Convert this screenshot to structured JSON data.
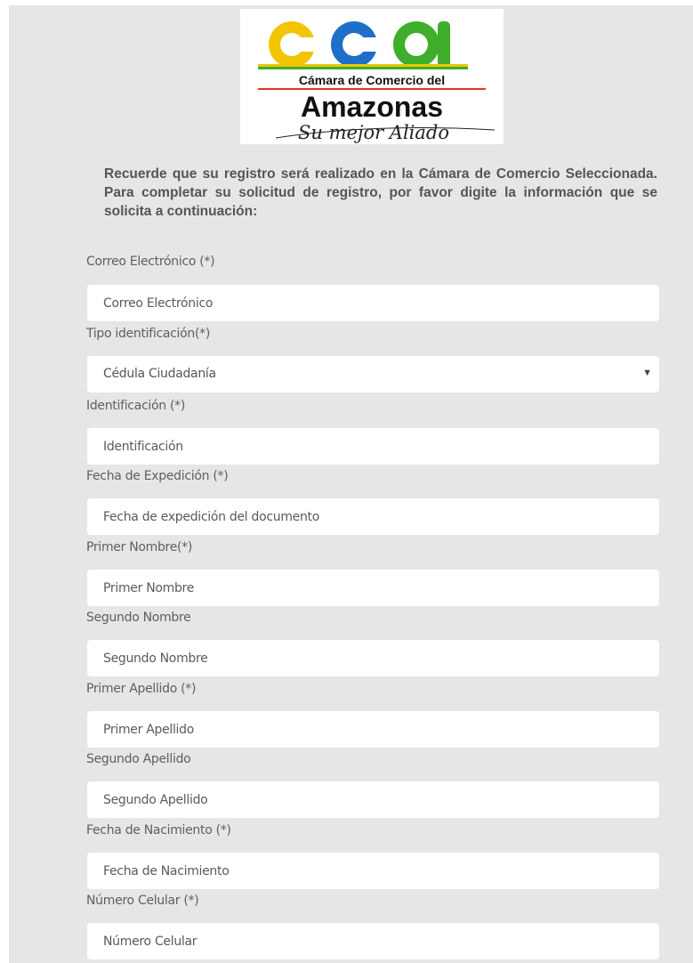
{
  "logo": {
    "line1": "Cámara de Comercio del",
    "line2": "Amazonas",
    "tagline": "Su mejor Aliado",
    "colors": {
      "yellow": "#f2c500",
      "blue": "#1e6fc8",
      "green": "#3fae2a",
      "red": "#e63228"
    }
  },
  "intro": "Recuerde que su registro será realizado en la Cámara de Comercio Seleccionada. Para completar su solicitud de registro, por favor digite la información que se solicita a continuación:",
  "form": {
    "email": {
      "label": "Correo Electrónico (*)",
      "placeholder": "Correo Electrónico"
    },
    "id_type": {
      "label": "Tipo identificación(*)",
      "selected": "Cédula Ciudadanía",
      "arrow_icon": "triangle-down-icon"
    },
    "id_number": {
      "label": "Identificación (*)",
      "placeholder": "Identificación"
    },
    "issue_date": {
      "label": "Fecha de Expedición (*)",
      "placeholder": "Fecha de expedición del documento"
    },
    "first_name": {
      "label": "Primer Nombre(*)",
      "placeholder": "Primer Nombre"
    },
    "second_name": {
      "label": "Segundo Nombre",
      "placeholder": "Segundo Nombre"
    },
    "first_surname": {
      "label": "Primer Apellido (*)",
      "placeholder": "Primer Apellido"
    },
    "second_surname": {
      "label": "Segundo Apellido",
      "placeholder": "Segundo Apellido"
    },
    "birth_date": {
      "label": "Fecha de Nacimiento (*)",
      "placeholder": "Fecha de Nacimiento"
    },
    "mobile": {
      "label": "Número Celular (*)",
      "placeholder": "Número Celular"
    }
  }
}
